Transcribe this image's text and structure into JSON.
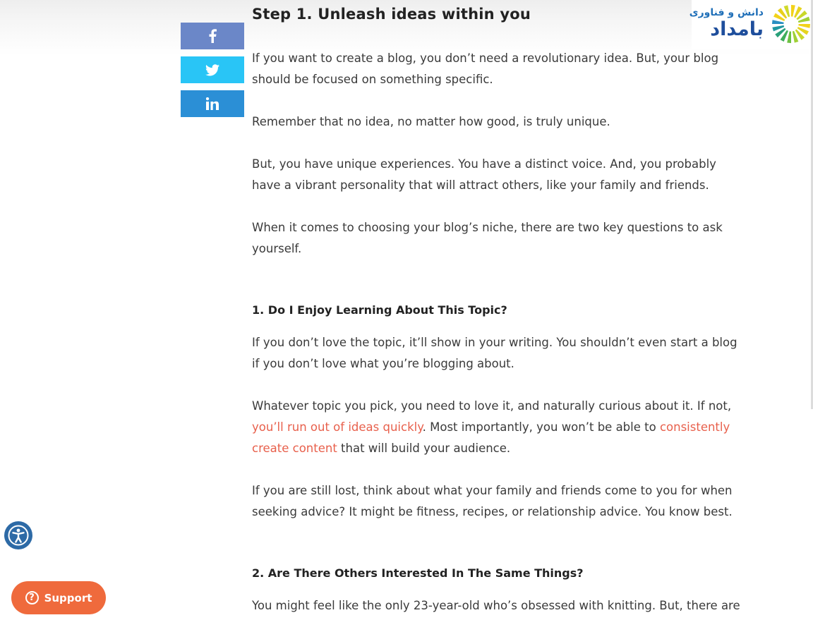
{
  "logo": {
    "line1": "دانش و فناوری",
    "line2": "بامداد"
  },
  "share": {
    "facebook_icon": "facebook-icon",
    "twitter_icon": "twitter-icon",
    "linkedin_icon": "linkedin-icon"
  },
  "article": {
    "step_heading": "Step 1. Unleash ideas within you",
    "p1": "If you want to create a blog, you don’t need a revolutionary idea. But, your blog should be focused on something specific.",
    "p2": "Remember that no idea, no matter how good, is truly unique.",
    "p3": "But, you have unique experiences. You have a distinct voice. And, you probably have a vibrant personality that will attract others, like your family and friends.",
    "p4": "When it comes to choosing your blog’s niche, there are two key questions to ask yourself.",
    "q1_heading": "1. Do I Enjoy Learning About This Topic?",
    "p5": "If you don’t love the topic, it’ll show in your writing. You shouldn’t even start a blog if you don’t love what you’re blogging about.",
    "p6_a": "Whatever topic you pick, you need to love it, and naturally curious about it.  If not, ",
    "p6_link1": "you’ll run out of ideas quickly",
    "p6_b": ". Most importantly, you won’t be able to ",
    "p6_link2": "consistently create content",
    "p6_c": " that will build your audience.",
    "p7": "If you are still lost, think about what your family and friends come to you for when seeking advice? It might be fitness, recipes, or relationship advice. You know best.",
    "q2_heading": "2. Are There Others Interested In The Same Things?",
    "p8": "You might feel like the only 23-year-old who’s obsessed with knitting. But, there are"
  },
  "widgets": {
    "accessibility_icon": "accessibility-icon",
    "support_label": "Support",
    "support_icon_glyph": "?"
  },
  "colors": {
    "link": "#e8604c",
    "facebook": "#6b87c8",
    "twitter": "#29c5f6",
    "linkedin": "#2b8fd6",
    "support": "#ef6a3c",
    "accessibility": "#2d6aa6"
  }
}
